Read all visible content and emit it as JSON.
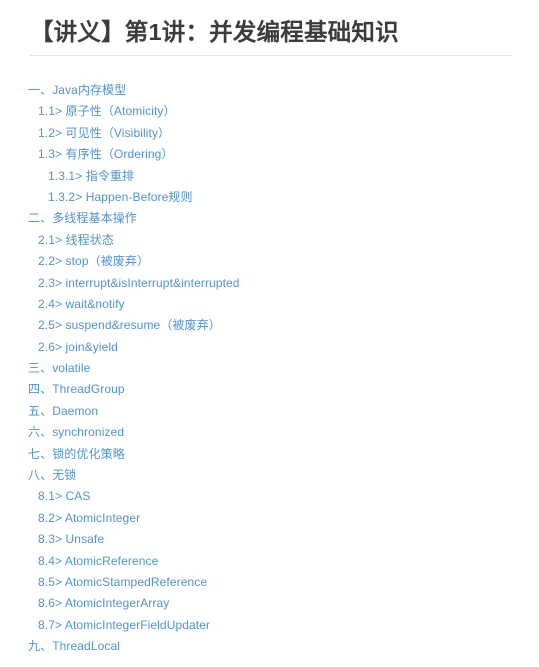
{
  "document": {
    "title": "【讲义】第1讲：并发编程基础知识",
    "background_color": "#ffffff",
    "title_color": "#3c3c3c",
    "link_color": "#4e93dd",
    "rule_color": "#e4e4e4"
  },
  "toc": {
    "items": [
      {
        "label": "一、Java内存模型",
        "level": 1
      },
      {
        "label": "1.1> 原子性（Atomicity）",
        "level": 2
      },
      {
        "label": "1.2> 可见性（Visibility）",
        "level": 2
      },
      {
        "label": "1.3> 有序性（Ordering）",
        "level": 2
      },
      {
        "label": "1.3.1> 指令重排",
        "level": 3
      },
      {
        "label": "1.3.2> Happen-Before规则",
        "level": 3
      },
      {
        "label": "二、多线程基本操作",
        "level": 1
      },
      {
        "label": "2.1> 线程状态",
        "level": 2
      },
      {
        "label": "2.2> stop（被废弃）",
        "level": 2
      },
      {
        "label": "2.3> interrupt&isInterrupt&interrupted",
        "level": 2
      },
      {
        "label": "2.4> wait&notify",
        "level": 2
      },
      {
        "label": "2.5> suspend&resume（被废弃）",
        "level": 2
      },
      {
        "label": "2.6> join&yield",
        "level": 2
      },
      {
        "label": "三、volatile",
        "level": 1
      },
      {
        "label": "四、ThreadGroup",
        "level": 1
      },
      {
        "label": "五、Daemon",
        "level": 1
      },
      {
        "label": "六、synchronized",
        "level": 1
      },
      {
        "label": "七、锁的优化策略",
        "level": 1
      },
      {
        "label": "八、无锁",
        "level": 1
      },
      {
        "label": "8.1> CAS",
        "level": 2
      },
      {
        "label": "8.2> AtomicInteger",
        "level": 2
      },
      {
        "label": "8.3> Unsafe",
        "level": 2
      },
      {
        "label": "8.4> AtomicReference",
        "level": 2
      },
      {
        "label": "8.5> AtomicStampedReference",
        "level": 2
      },
      {
        "label": "8.6> AtomicIntegerArray",
        "level": 2
      },
      {
        "label": "8.7> AtomicIntegerFieldUpdater",
        "level": 2
      },
      {
        "label": "九、ThreadLocal",
        "level": 1
      }
    ]
  }
}
